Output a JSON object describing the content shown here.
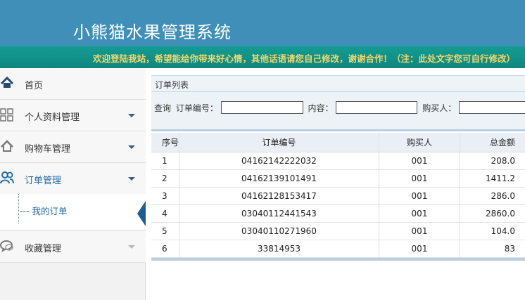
{
  "header": {
    "title": "小熊猫水果管理系统",
    "welcome": "欢迎登陆我站，希望能给你带来好心情，其他话语请您自己修改，谢谢合作！（注：此处文字您可自行修改）"
  },
  "sidebar": {
    "items": [
      {
        "label": "首页",
        "icon": "home-icon"
      },
      {
        "label": "个人资料管理",
        "icon": "grid-icon"
      },
      {
        "label": "购物车管理",
        "icon": "home-outline-icon"
      },
      {
        "label": "订单管理",
        "icon": "users-icon"
      },
      {
        "label": "收藏管理",
        "icon": "chat-icon"
      }
    ],
    "subitem": {
      "label": "我的订单"
    }
  },
  "main": {
    "breadcrumb": "订单列表",
    "search": {
      "prefix": "查询",
      "order_label": "订单编号：",
      "content_label": "内容：",
      "buyer_label": "购买人：",
      "order_value": "",
      "content_value": "",
      "buyer_value": ""
    },
    "table": {
      "headers": [
        "序号",
        "订单编号",
        "购买人",
        "总金额"
      ],
      "rows": [
        [
          "1",
          "04162142222032",
          "001",
          "208.0"
        ],
        [
          "2",
          "04162139101491",
          "001",
          "1411.2"
        ],
        [
          "3",
          "04162128153417",
          "001",
          "286.0"
        ],
        [
          "4",
          "03040112441543",
          "001",
          "2860.0"
        ],
        [
          "5",
          "03040110271960",
          "001",
          "104.0"
        ],
        [
          "6",
          "33814953",
          "001",
          "83"
        ]
      ]
    }
  },
  "colors": {
    "header_bg": "#3f8fb9",
    "welcome_bg": "#129489",
    "welcome_text": "#f5d76a",
    "active_link": "#1c6aa8"
  }
}
